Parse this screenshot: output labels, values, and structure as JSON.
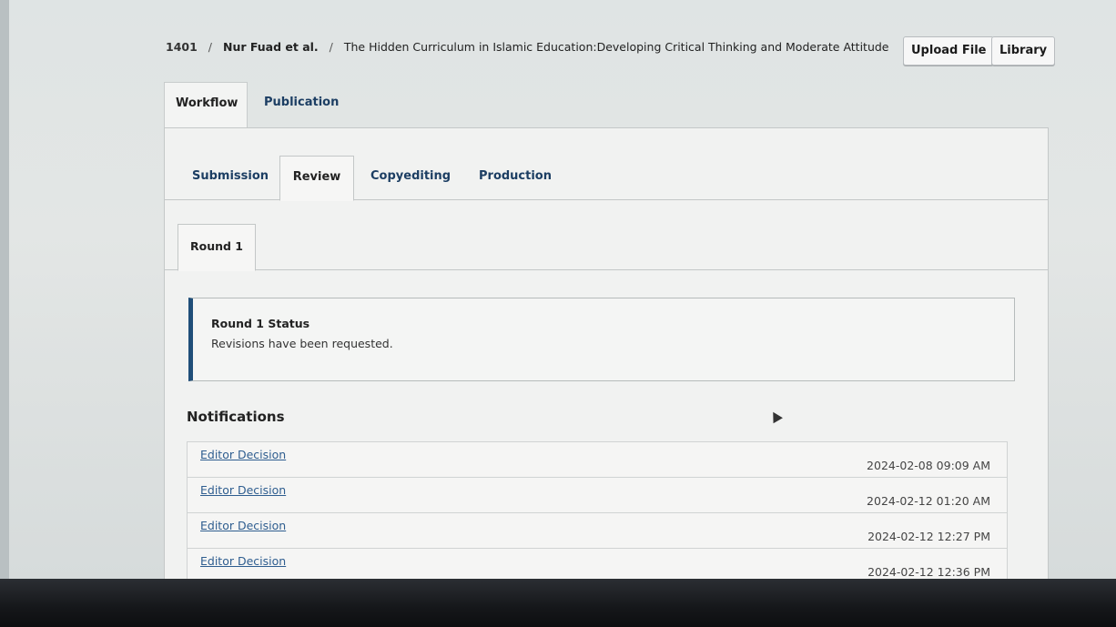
{
  "header": {
    "breadcrumb": {
      "id": "1401",
      "separator": "/",
      "authors": "Nur Fuad et al.",
      "title": "The Hidden Curriculum in Islamic Education:Developing Critical Thinking and Moderate Attitude"
    },
    "buttons": {
      "upload_file": "Upload File",
      "library": "Library"
    }
  },
  "main_tabs": [
    {
      "label": "Workflow",
      "active": true
    },
    {
      "label": "Publication",
      "active": false
    }
  ],
  "stage_tabs": [
    {
      "label": "Submission",
      "active": false
    },
    {
      "label": "Review",
      "active": true
    },
    {
      "label": "Copyediting",
      "active": false
    },
    {
      "label": "Production",
      "active": false
    }
  ],
  "round_tabs": [
    {
      "label": "Round 1",
      "active": true
    }
  ],
  "round_status": {
    "title": "Round 1 Status",
    "text": "Revisions have been requested."
  },
  "notifications": {
    "heading": "Notifications",
    "items": [
      {
        "label": "Editor Decision",
        "date": "2024-02-08 09:09 AM"
      },
      {
        "label": "Editor Decision",
        "date": "2024-02-12 01:20 AM"
      },
      {
        "label": "Editor Decision",
        "date": "2024-02-12 12:27 PM"
      },
      {
        "label": "Editor Decision",
        "date": "2024-02-12 12:36 PM"
      }
    ]
  },
  "colors": {
    "link": "#2e5d8f",
    "tab_text": "#1c3e63",
    "status_accent": "#1f4e79"
  }
}
